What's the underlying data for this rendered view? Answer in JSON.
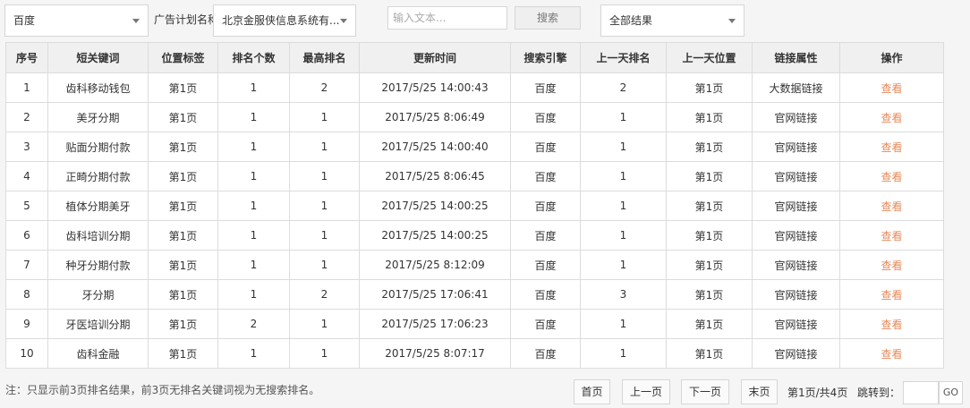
{
  "filters": {
    "engine_select": "百度",
    "plan_label": "广告计划名称",
    "plan_select": "北京金服侠信息系统有...",
    "search_placeholder": "输入文本...",
    "search_button": "搜索",
    "result_select": "全部结果"
  },
  "table": {
    "headers": [
      "序号",
      "短关键词",
      "位置标签",
      "排名个数",
      "最高排名",
      "更新时间",
      "搜索引擎",
      "上一天排名",
      "上一天位置",
      "链接属性",
      "操作"
    ],
    "rows": [
      [
        "1",
        "齿科移动钱包",
        "第1页",
        "1",
        "2",
        "2017/5/25 14:00:43",
        "百度",
        "2",
        "第1页",
        "大数据链接",
        "查看"
      ],
      [
        "2",
        "美牙分期",
        "第1页",
        "1",
        "1",
        "2017/5/25 8:06:49",
        "百度",
        "1",
        "第1页",
        "官网链接",
        "查看"
      ],
      [
        "3",
        "贴面分期付款",
        "第1页",
        "1",
        "1",
        "2017/5/25 14:00:40",
        "百度",
        "1",
        "第1页",
        "官网链接",
        "查看"
      ],
      [
        "4",
        "正畸分期付款",
        "第1页",
        "1",
        "1",
        "2017/5/25 8:06:45",
        "百度",
        "1",
        "第1页",
        "官网链接",
        "查看"
      ],
      [
        "5",
        "植体分期美牙",
        "第1页",
        "1",
        "1",
        "2017/5/25 14:00:25",
        "百度",
        "1",
        "第1页",
        "官网链接",
        "查看"
      ],
      [
        "6",
        "齿科培训分期",
        "第1页",
        "1",
        "1",
        "2017/5/25 14:00:25",
        "百度",
        "1",
        "第1页",
        "官网链接",
        "查看"
      ],
      [
        "7",
        "种牙分期付款",
        "第1页",
        "1",
        "1",
        "2017/5/25 8:12:09",
        "百度",
        "1",
        "第1页",
        "官网链接",
        "查看"
      ],
      [
        "8",
        "牙分期",
        "第1页",
        "1",
        "2",
        "2017/5/25 17:06:41",
        "百度",
        "3",
        "第1页",
        "官网链接",
        "查看"
      ],
      [
        "9",
        "牙医培训分期",
        "第1页",
        "2",
        "1",
        "2017/5/25 17:06:23",
        "百度",
        "1",
        "第1页",
        "官网链接",
        "查看"
      ],
      [
        "10",
        "齿科金融",
        "第1页",
        "1",
        "1",
        "2017/5/25 8:07:17",
        "百度",
        "1",
        "第1页",
        "官网链接",
        "查看"
      ]
    ]
  },
  "footer": {
    "note": "注：只显示前3页排名结果，前3页无排名关键词视为无搜索排名。",
    "first": "首页",
    "prev": "上一页",
    "next": "下一页",
    "last": "末页",
    "page_info": "第1页/共4页",
    "jump_label": "跳转到：",
    "go": "GO"
  },
  "colors": {
    "action_link": "#e8895a"
  }
}
